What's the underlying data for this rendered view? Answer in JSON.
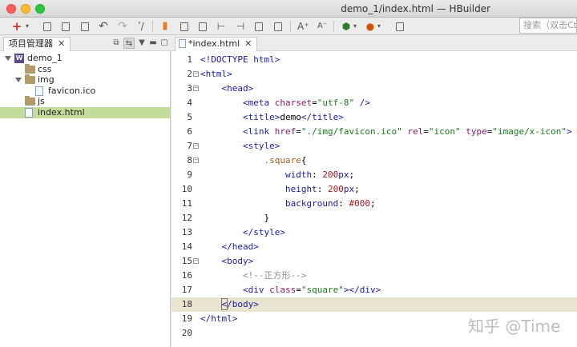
{
  "window": {
    "title": "demo_1/index.html — HBuilder"
  },
  "toolbar": {
    "search_placeholder": "搜索（双击Ctrl）"
  },
  "project_panel": {
    "title": "项目管理器",
    "tree": [
      {
        "label": "demo_1",
        "type": "project",
        "depth": 0,
        "expanded": true
      },
      {
        "label": "css",
        "type": "folder",
        "depth": 1,
        "expanded": false
      },
      {
        "label": "img",
        "type": "folder",
        "depth": 1,
        "expanded": true
      },
      {
        "label": "favicon.ico",
        "type": "file",
        "depth": 2
      },
      {
        "label": "js",
        "type": "folder",
        "depth": 1,
        "expanded": false
      },
      {
        "label": "index.html",
        "type": "file",
        "depth": 1,
        "selected": true
      }
    ]
  },
  "editor": {
    "tab_label": "*index.html",
    "current_line": 18,
    "lines": [
      {
        "n": "1",
        "fold": false,
        "html": "<span class=\"tag\">&lt;!DOCTYPE html&gt;</span>"
      },
      {
        "n": "2",
        "fold": true,
        "html": "<span class=\"tag\">&lt;html&gt;</span>"
      },
      {
        "n": "3",
        "fold": true,
        "html": "    <span class=\"tag\">&lt;head&gt;</span>"
      },
      {
        "n": "4",
        "fold": false,
        "html": "        <span class=\"tag\">&lt;meta</span> <span class=\"attr\">charset</span>=<span class=\"str\">\"utf-8\"</span> <span class=\"tag\">/&gt;</span>"
      },
      {
        "n": "5",
        "fold": false,
        "html": "        <span class=\"tag\">&lt;title&gt;</span>demo<span class=\"tag\">&lt;/title&gt;</span>"
      },
      {
        "n": "6",
        "fold": false,
        "html": "        <span class=\"tag\">&lt;link</span> <span class=\"attr\">href</span>=<span class=\"str\">\"./img/favicon.ico\"</span> <span class=\"attr\">rel</span>=<span class=\"str\">\"icon\"</span> <span class=\"attr\">type</span>=<span class=\"str\">\"image/x-icon\"</span><span class=\"tag\">&gt;</span>"
      },
      {
        "n": "7",
        "fold": true,
        "html": "        <span class=\"tag\">&lt;style&gt;</span>"
      },
      {
        "n": "8",
        "fold": true,
        "html": "            <span class=\"sel\">.square</span>{"
      },
      {
        "n": "9",
        "fold": false,
        "html": "                <span class=\"prop\">width</span>: <span class=\"num\">200</span><span class=\"prop\">px</span>;"
      },
      {
        "n": "10",
        "fold": false,
        "html": "                <span class=\"prop\">height</span>: <span class=\"num\">200</span><span class=\"prop\">px</span>;"
      },
      {
        "n": "11",
        "fold": false,
        "html": "                <span class=\"prop\">background</span>: <span class=\"num\">#000</span>;"
      },
      {
        "n": "12",
        "fold": false,
        "html": "            }"
      },
      {
        "n": "13",
        "fold": false,
        "html": "        <span class=\"tag\">&lt;/style&gt;</span>"
      },
      {
        "n": "14",
        "fold": false,
        "html": "    <span class=\"tag\">&lt;/head&gt;</span>"
      },
      {
        "n": "15",
        "fold": true,
        "html": "    <span class=\"tag\">&lt;body&gt;</span>"
      },
      {
        "n": "16",
        "fold": false,
        "html": "        <span class=\"cmt\">&lt;!--正方形--&gt;</span>"
      },
      {
        "n": "17",
        "fold": false,
        "html": "        <span class=\"tag\">&lt;div</span> <span class=\"attr\">class</span>=<span class=\"str\">\"square\"</span><span class=\"tag\">&gt;&lt;/div&gt;</span>"
      },
      {
        "n": "18",
        "fold": false,
        "html": "    <span class=\"tag\"><span class=\"cursorbox\">&lt;</span>/body&gt;</span>"
      },
      {
        "n": "19",
        "fold": false,
        "html": "<span class=\"tag\">&lt;/html&gt;</span>"
      },
      {
        "n": "20",
        "fold": false,
        "html": ""
      }
    ]
  },
  "watermark": "知乎 @Time"
}
